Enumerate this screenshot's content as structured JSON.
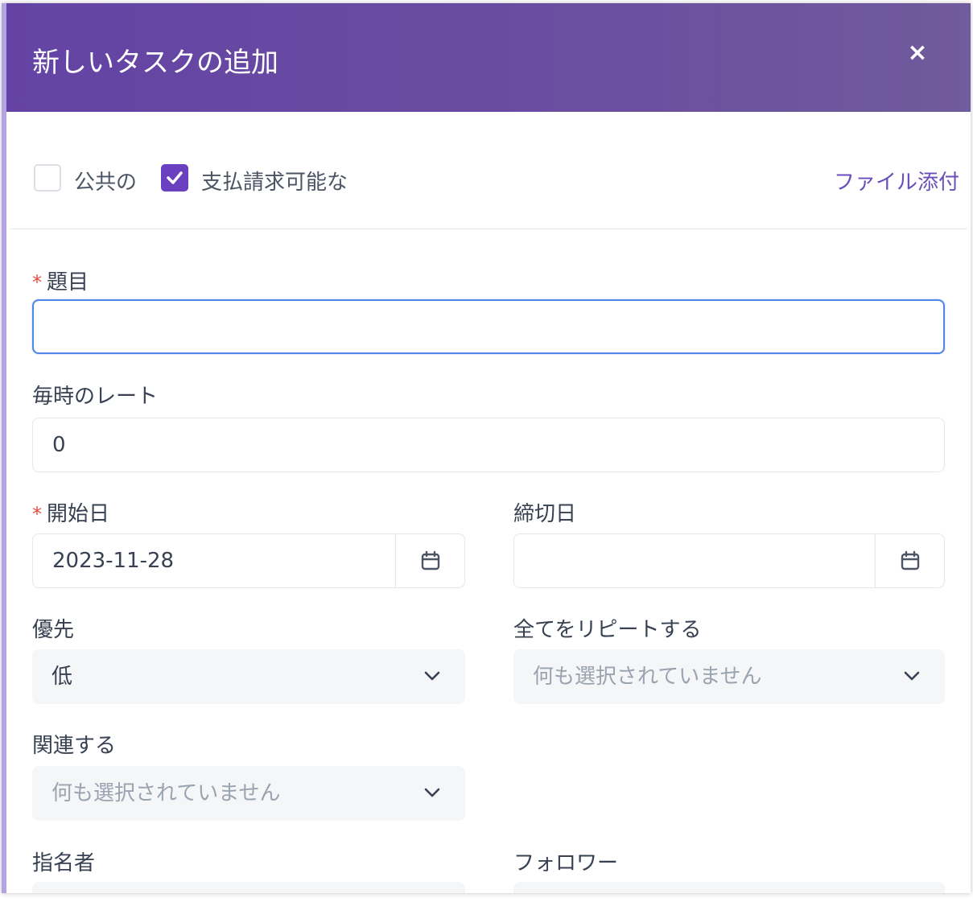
{
  "modal": {
    "title": "新しいタスクの追加",
    "close_symbol": "×"
  },
  "options": {
    "public_label": "公共の",
    "public_checked": false,
    "billable_label": "支払請求可能な",
    "billable_checked": true,
    "attach_label": "ファイル添付"
  },
  "fields": {
    "subject": {
      "label": "題目",
      "required": "*",
      "value": ""
    },
    "hourly_rate": {
      "label": "毎時のレート",
      "value": "0"
    },
    "start_date": {
      "label": "開始日",
      "required": "*",
      "value": "2023-11-28"
    },
    "due_date": {
      "label": "締切日",
      "value": ""
    },
    "priority": {
      "label": "優先",
      "value": "低"
    },
    "repeat": {
      "label": "全てをリピートする",
      "placeholder": "何も選択されていません"
    },
    "related": {
      "label": "関連する",
      "placeholder": "何も選択されていません"
    },
    "assignees": {
      "label": "指名者"
    },
    "followers": {
      "label": "フォロワー"
    }
  },
  "icons": {
    "close": "close-icon",
    "check": "checkmark-icon",
    "calendar": "calendar-icon",
    "chevron": "chevron-down-icon"
  },
  "colors": {
    "header": "#6443a4",
    "accent": "#6a3fc0",
    "link": "#6a4fb8",
    "focus": "#4f86e8",
    "required": "#e74c3c"
  }
}
